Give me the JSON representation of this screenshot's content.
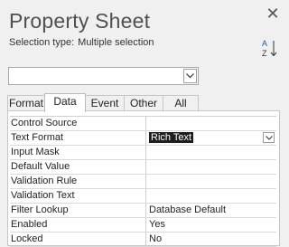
{
  "window": {
    "title": "Property Sheet",
    "close_icon": "close-icon",
    "sort_icon": "sort-az-icon"
  },
  "selection": {
    "label": "Selection type:",
    "value": "Multiple selection"
  },
  "object_combo": {
    "value": "",
    "dropdown_icon": "chevron-down-icon"
  },
  "tabs": [
    {
      "label": "Format",
      "active": false
    },
    {
      "label": "Data",
      "active": true
    },
    {
      "label": "Event",
      "active": false
    },
    {
      "label": "Other",
      "active": false
    },
    {
      "label": "All",
      "active": false
    }
  ],
  "properties": [
    {
      "label": "Control Source",
      "value": ""
    },
    {
      "label": "Text Format",
      "value": "Rich Text",
      "selected": true,
      "has_dropdown": true
    },
    {
      "label": "Input Mask",
      "value": ""
    },
    {
      "label": "Default Value",
      "value": ""
    },
    {
      "label": "Validation Rule",
      "value": ""
    },
    {
      "label": "Validation Text",
      "value": ""
    },
    {
      "label": "Filter Lookup",
      "value": "Database Default"
    },
    {
      "label": "Enabled",
      "value": "Yes"
    },
    {
      "label": "Locked",
      "value": "No"
    }
  ],
  "colors": {
    "background": "#f0f0f0",
    "title": "#505050",
    "selection_highlight": "#1e1e1e"
  }
}
